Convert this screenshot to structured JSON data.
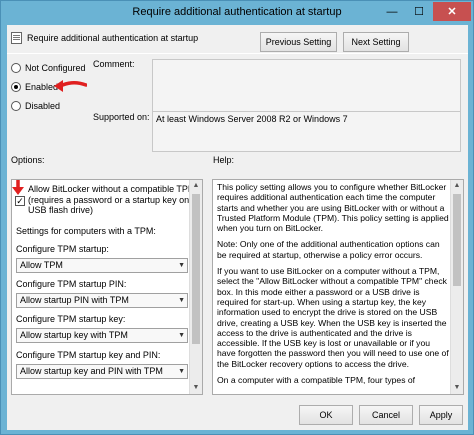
{
  "window": {
    "title": "Require additional authentication at startup",
    "min": "—",
    "max": "☐",
    "close": "✕"
  },
  "header": {
    "title": "Require additional authentication at startup"
  },
  "nav": {
    "previous": "Previous Setting",
    "next": "Next Setting"
  },
  "state": {
    "options": [
      "Not Configured",
      "Enabled",
      "Disabled"
    ],
    "selected": "Enabled"
  },
  "comment_label": "Comment:",
  "supported": {
    "label": "Supported on:",
    "value": "At least Windows Server 2008 R2 or Windows 7"
  },
  "options_label": "Options:",
  "help_label": "Help:",
  "options": {
    "allow_without_tpm": {
      "line1": "Allow BitLocker without a compatible TPM",
      "line2": "(requires a password or a startup key on a",
      "line3": "USB flash drive)",
      "checked": true
    },
    "settings_heading": "Settings for computers with a TPM:",
    "configure_tpm_startup": {
      "label": "Configure TPM startup:",
      "value": "Allow TPM"
    },
    "configure_tpm_pin": {
      "label": "Configure TPM startup PIN:",
      "value": "Allow startup PIN with TPM"
    },
    "configure_tpm_key": {
      "label": "Configure TPM startup key:",
      "value": "Allow startup key with TPM"
    },
    "configure_tpm_key_pin": {
      "label": "Configure TPM startup key and PIN:",
      "value": "Allow startup key and PIN with TPM"
    }
  },
  "help": {
    "p1": "This policy setting allows you to configure whether BitLocker requires additional authentication each time the computer starts and whether you are using BitLocker with or without a Trusted Platform Module (TPM). This policy setting is applied when you turn on BitLocker.",
    "p2": "Note: Only one of the additional authentication options can be required at startup, otherwise a policy error occurs.",
    "p3": "If you want to use BitLocker on a computer without a TPM, select the \"Allow BitLocker without a compatible TPM\" check box. In this mode either a password or a USB drive is required for start-up. When using a startup key, the key information used to encrypt the drive is stored on the USB drive, creating a USB key. When the USB key is inserted the access to the drive is authenticated and the drive is accessible. If the USB key is lost or unavailable or if you have forgotten the password then you will need to use one of the BitLocker recovery options to access the drive.",
    "p4": "On a computer with a compatible TPM, four types of"
  },
  "buttons": {
    "ok": "OK",
    "cancel": "Cancel",
    "apply": "Apply"
  },
  "colors": {
    "titlebar": "#6bb3d4",
    "close": "#c75050",
    "annotation_arrow": "#e02020"
  }
}
